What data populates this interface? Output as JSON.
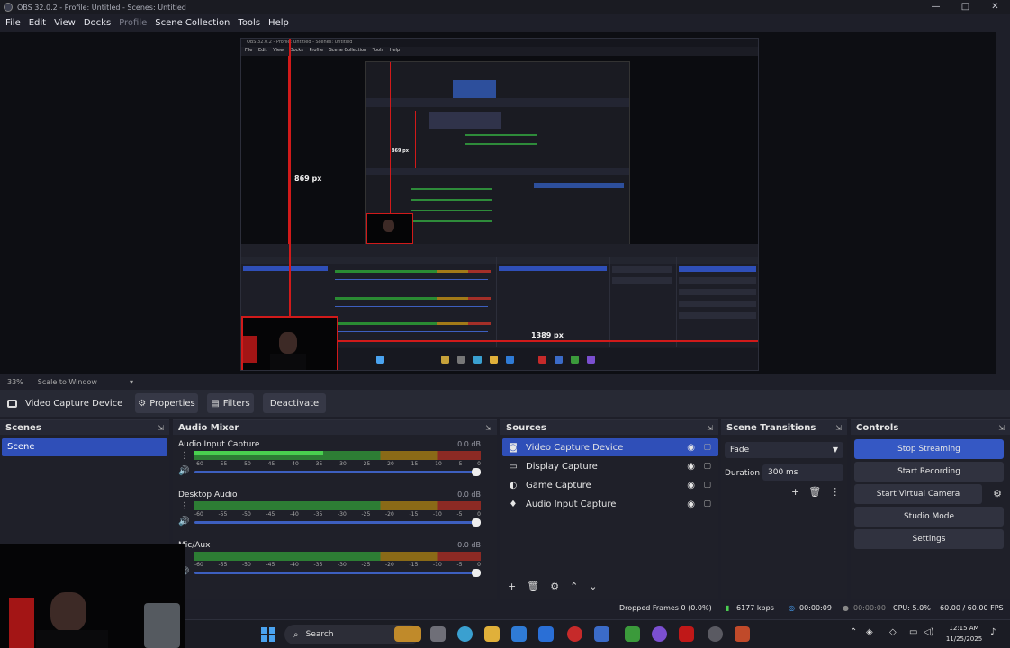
{
  "window": {
    "title": "OBS 32.0.2 - Profile: Untitled - Scenes: Untitled",
    "controls": [
      "—",
      "□",
      "✕"
    ]
  },
  "menu": [
    "File",
    "Edit",
    "View",
    "Docks",
    "Profile",
    "Scene Collection",
    "Tools",
    "Help"
  ],
  "preview": {
    "zoom": "33%",
    "scale_mode": "Scale to Window",
    "labels": {
      "height_px": "869 px",
      "width_px": "1389 px",
      "inner_px": "869 px"
    },
    "nested_menu": [
      "File",
      "Edit",
      "View",
      "Docks",
      "Profile",
      "Scene Collection",
      "Tools",
      "Help"
    ]
  },
  "source_toolbar": {
    "source_name": "Video Capture Device",
    "properties": "Properties",
    "filters": "Filters",
    "deactivate": "Deactivate"
  },
  "scenes": {
    "title": "Scenes",
    "items": [
      "Scene"
    ]
  },
  "mixer": {
    "title": "Audio Mixer",
    "ticks": [
      "-60",
      "-55",
      "-50",
      "-45",
      "-40",
      "-35",
      "-30",
      "-25",
      "-20",
      "-15",
      "-10",
      "-5",
      "0"
    ],
    "channels": [
      {
        "name": "Audio Input Capture",
        "db": "0.0 dB",
        "level": 0.45
      },
      {
        "name": "Desktop Audio",
        "db": "0.0 dB",
        "level": 0.0
      },
      {
        "name": "Mic/Aux",
        "db": "0.0 dB",
        "level": 0.0
      }
    ]
  },
  "sources": {
    "title": "Sources",
    "items": [
      {
        "label": "Video Capture Device",
        "icon": "camera-icon",
        "glyph": "◙",
        "selected": true
      },
      {
        "label": "Display Capture",
        "icon": "monitor-icon",
        "glyph": "▭",
        "selected": false
      },
      {
        "label": "Game Capture",
        "icon": "gamepad-icon",
        "glyph": "◐",
        "selected": false
      },
      {
        "label": "Audio Input Capture",
        "icon": "microphone-icon",
        "glyph": "♦",
        "selected": false
      }
    ]
  },
  "transitions": {
    "title": "Scene Transitions",
    "type": "Fade",
    "duration_label": "Duration",
    "duration": "300 ms"
  },
  "controls": {
    "title": "Controls",
    "buttons": [
      "Stop Streaming",
      "Start Recording",
      "Start Virtual Camera",
      "Studio Mode",
      "Settings"
    ]
  },
  "status": {
    "dropped": "Dropped Frames 0 (0.0%)",
    "bitrate": "6177 kbps",
    "stream_time": "00:00:09",
    "rec_time": "00:00:00",
    "cpu": "CPU: 5.0%",
    "fps": "60.00 / 60.00 FPS"
  },
  "taskbar": {
    "search": "Search",
    "time": "12:15 AM",
    "date": "11/25/2025"
  },
  "colors": {
    "accent": "#3558c4",
    "background": "#1e1f29",
    "guide_red": "#d11a1a"
  }
}
